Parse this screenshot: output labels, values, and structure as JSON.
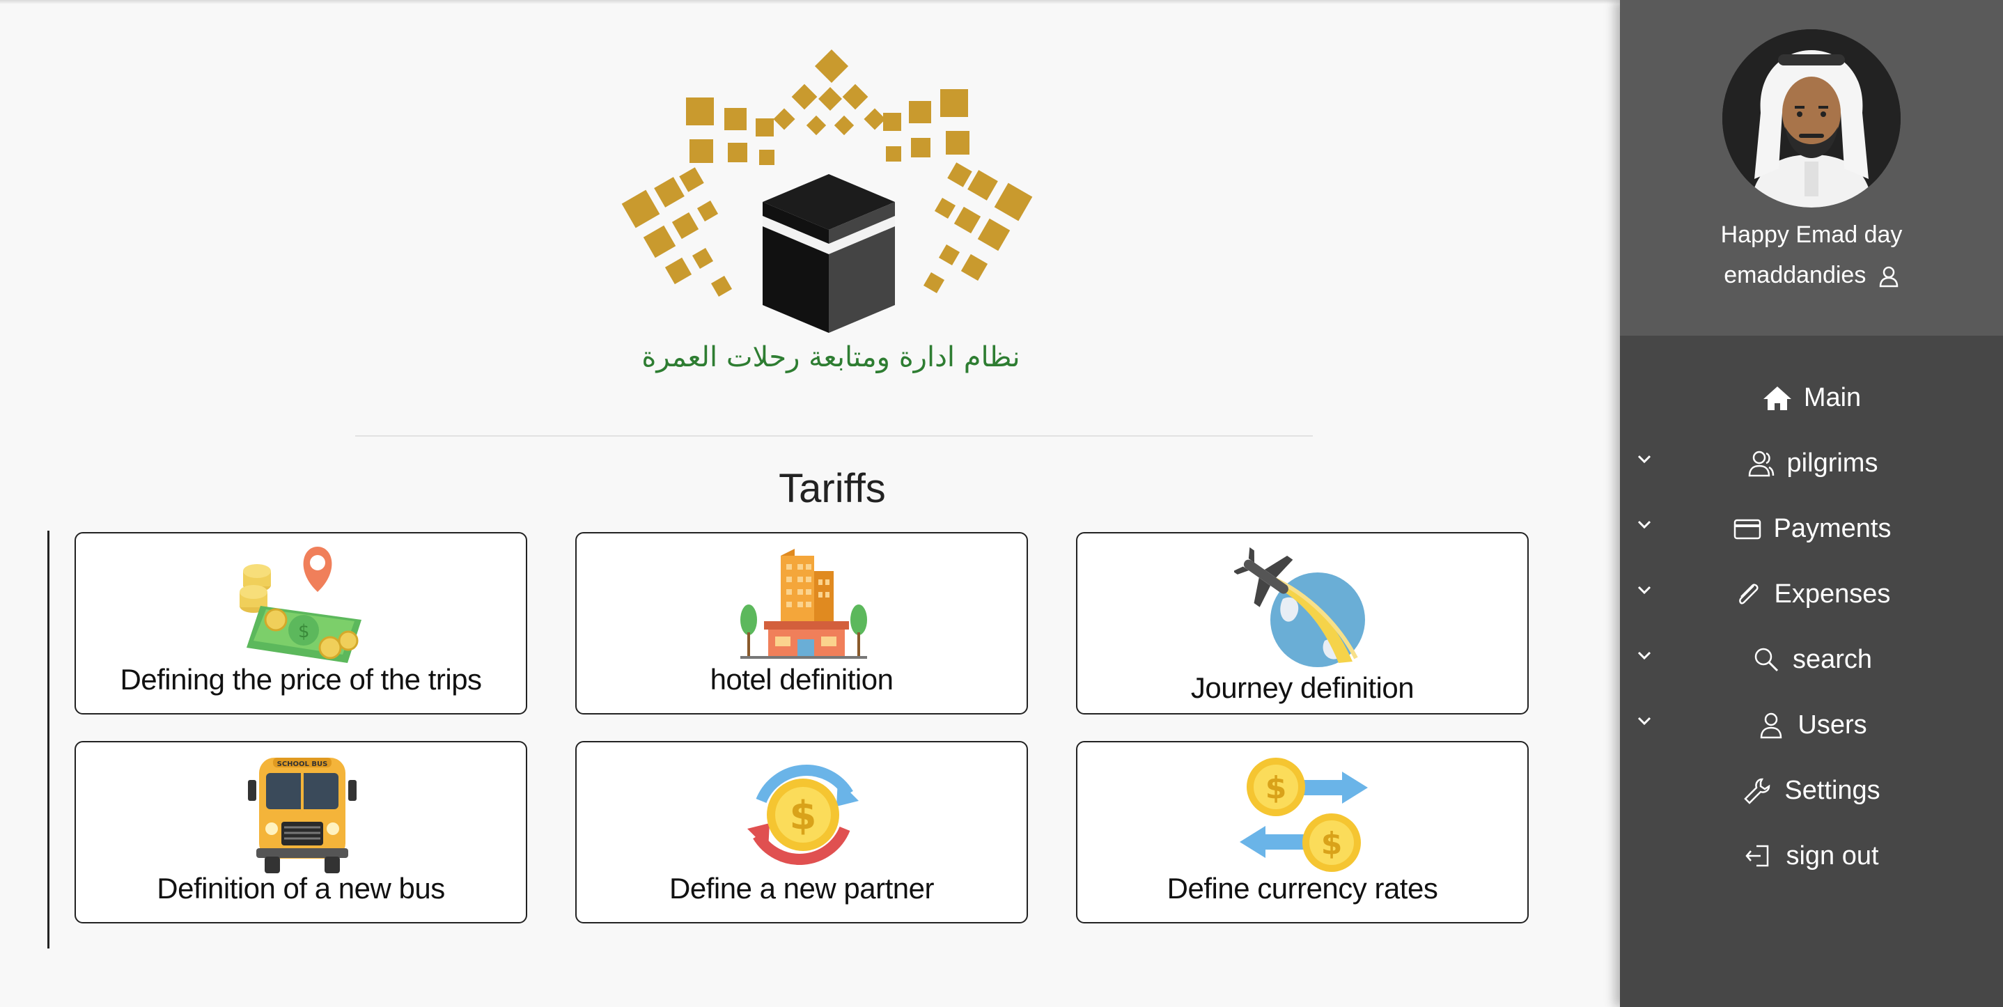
{
  "logo": {
    "text": "نظام ادارة ومتابعة رحلات العمرة"
  },
  "section": {
    "title": "Tariffs"
  },
  "cards": [
    {
      "label": "Defining the price of the trips",
      "icon": "money-location-icon"
    },
    {
      "label": "hotel definition",
      "icon": "hotel-icon"
    },
    {
      "label": "Journey definition",
      "icon": "plane-globe-icon"
    },
    {
      "label": "Definition of a new bus",
      "icon": "school-bus-icon"
    },
    {
      "label": "Define a new partner",
      "icon": "coin-cycle-icon"
    },
    {
      "label": "Define currency rates",
      "icon": "currency-exchange-icon"
    }
  ],
  "bus_sign": "SCHOOL BUS",
  "profile": {
    "greeting": "Happy Emad day",
    "username": "emaddandies"
  },
  "menu": [
    {
      "label": "Main",
      "icon": "home-icon",
      "expandable": false
    },
    {
      "label": "pilgrims",
      "icon": "users-icon",
      "expandable": true
    },
    {
      "label": "Payments",
      "icon": "credit-card-icon",
      "expandable": true
    },
    {
      "label": "Expenses",
      "icon": "paperclip-icon",
      "expandable": true
    },
    {
      "label": "search",
      "icon": "search-icon",
      "expandable": true
    },
    {
      "label": "Users",
      "icon": "user-icon",
      "expandable": true
    },
    {
      "label": "Settings",
      "icon": "wrench-icon",
      "expandable": false
    },
    {
      "label": "sign out",
      "icon": "sign-out-icon",
      "expandable": false
    }
  ],
  "colors": {
    "gold": "#c99a2e",
    "sidebar": "#474747",
    "profile_bg": "#5a5a5a",
    "logo_text": "#2e7d32"
  }
}
